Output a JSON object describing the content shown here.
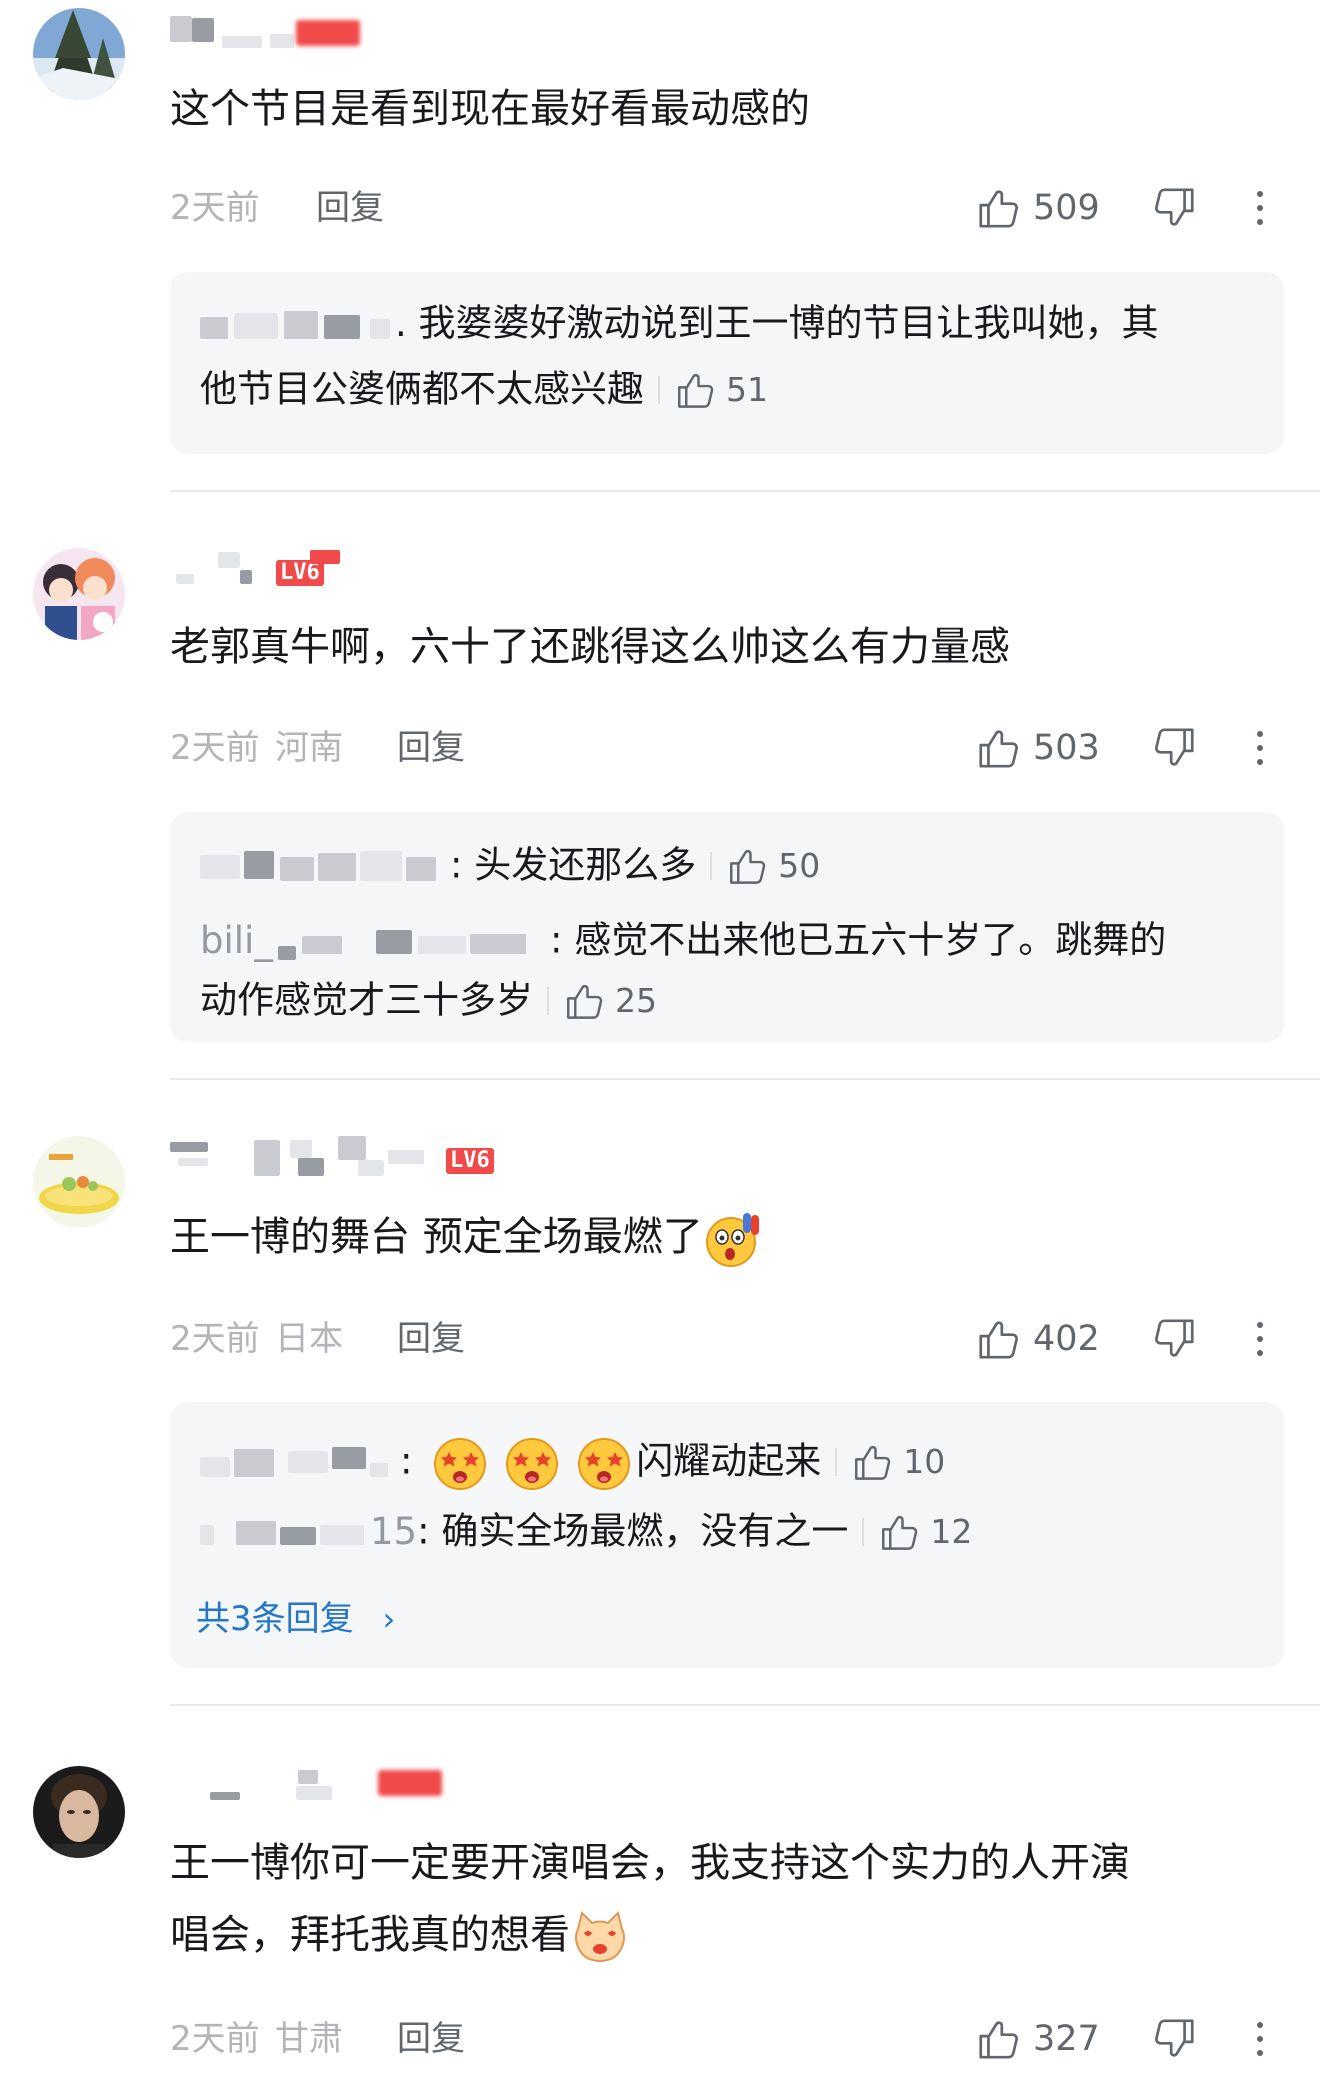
{
  "comments": [
    {
      "username": "",
      "text": "这个节目是看到现在最好看最动感的",
      "time": "2天前",
      "location": "",
      "reply_label": "回复",
      "likes": "509",
      "replies": [
        {
          "name": "",
          "text": "我婆婆好激动说到王一博的节目让我叫她，其",
          "likes": ""
        },
        {
          "name": "",
          "text": "他节目公婆俩都不太感兴趣",
          "likes": "51"
        }
      ]
    },
    {
      "username": "",
      "level": "LV6",
      "text": "老郭真牛啊，六十了还跳得这么帅这么有力量感",
      "time": "2天前",
      "location": "河南",
      "reply_label": "回复",
      "likes": "503",
      "replies": [
        {
          "name": "",
          "text": "头发还那么多",
          "likes": "50"
        },
        {
          "name": "bili_",
          "text": "感觉不出来他已五六十岁了。跳舞的",
          "likes": ""
        },
        {
          "name": "",
          "text": "动作感觉才三十多岁",
          "likes": "25"
        }
      ]
    },
    {
      "username": "",
      "level": "LV6",
      "text": "王一博的舞台 预定全场最燃了",
      "time": "2天前",
      "location": "日本",
      "reply_label": "回复",
      "likes": "402",
      "replies": [
        {
          "name": "",
          "text": "闪耀动起来",
          "likes": "10"
        },
        {
          "name": "",
          "name_suffix": "15",
          "text": "确实全场最燃，没有之一",
          "likes": "12"
        }
      ],
      "more_replies": "共3条回复"
    },
    {
      "username": "",
      "text_line1": "王一博你可一定要开演唱会，我支持这个实力的人开演",
      "text_line2": "唱会，拜托我真的想看",
      "time": "2天前",
      "location": "甘肃",
      "reply_label": "回复",
      "likes": "327"
    }
  ],
  "icons": {
    "like": "thumbs-up-icon",
    "dislike": "thumbs-down-icon",
    "more": "more-vertical-icon",
    "chevron": "chevron-right-icon"
  },
  "colors": {
    "text": "#18191c",
    "meta": "#b2b4b8",
    "action": "#61666d",
    "link": "#2376c8",
    "level_badge": "#f04a4a",
    "reply_bg": "#f5f6f7"
  }
}
